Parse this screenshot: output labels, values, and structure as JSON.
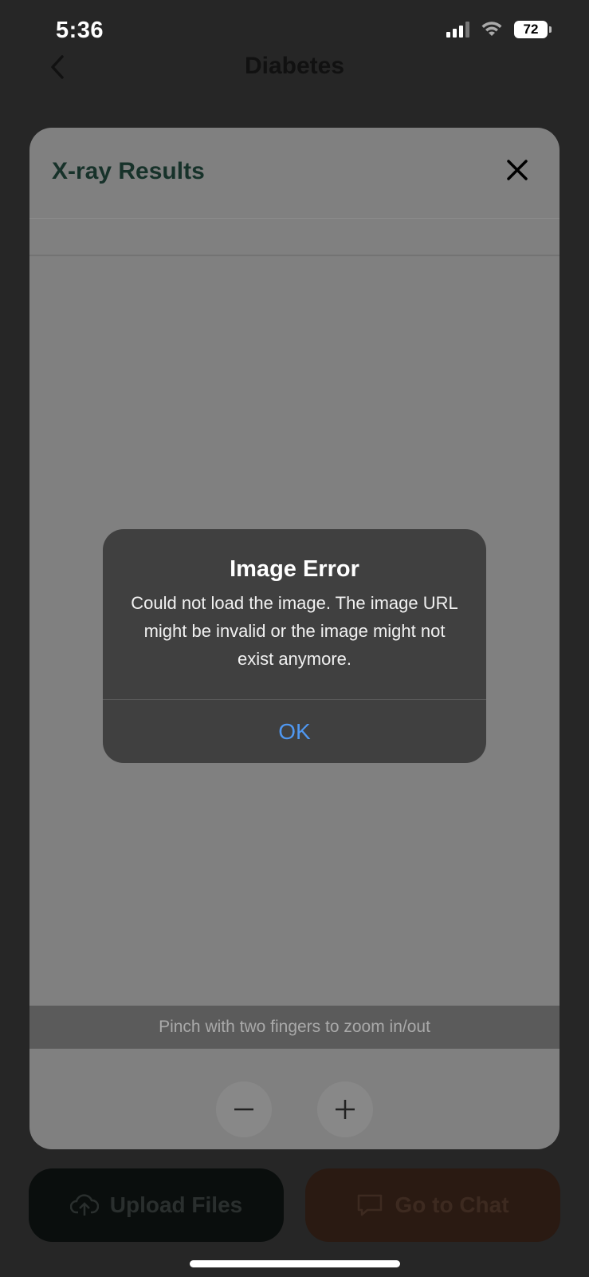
{
  "status_bar": {
    "time": "5:36",
    "battery": "72"
  },
  "nav": {
    "title": "Diabetes"
  },
  "sheet": {
    "title": "X-ray Results",
    "zoom_hint": "Pinch with two fingers to zoom in/out"
  },
  "alert": {
    "title": "Image Error",
    "message": "Could not load the image. The image URL might be invalid or the image might not exist anymore.",
    "ok_label": "OK"
  },
  "bottom_actions": {
    "upload_label": "Upload Files",
    "chat_label": "Go to Chat"
  },
  "colors": {
    "accent_blue": "#4f97f0",
    "sheet_title": "#17322a"
  },
  "icons": [
    "chevron-left-icon",
    "close-icon",
    "minus-icon",
    "plus-icon",
    "cloud-upload-icon",
    "chat-bubble-icon",
    "signal-icon",
    "wifi-icon",
    "battery-icon"
  ]
}
